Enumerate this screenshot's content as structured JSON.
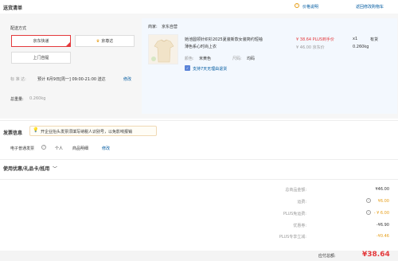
{
  "header": {
    "title": "送货清单",
    "price_note": "价格说明",
    "back_cart": "返回修改购物车"
  },
  "delivery": {
    "section_label": "配送方式",
    "options": [
      "京东快递",
      "京尊达",
      "上门自提"
    ],
    "selected_index": 0,
    "time_label": "标 准 达:",
    "time_value": "预计 6月9日[周一] 09:00-21:00 送达",
    "modify": "修改",
    "weight_label": "总重量:",
    "weight_value": "0.260kg"
  },
  "merchant": {
    "label": "商家:",
    "name": "京东自营"
  },
  "product": {
    "title_line1": "她池圆领针织衫2025夏装新款女装简约短袖",
    "title_line2": "薄色系心时尚上衣",
    "price": "¥ 38.64 PLUS到手价",
    "orig_price": "¥ 46.00 京东价",
    "qty": "x1",
    "stock": "有货",
    "weight": "0.260kg",
    "color_label": "颜色:",
    "color_value": "米黄色",
    "size_label": "尺码:",
    "size_value": "均码",
    "return_policy": "支持7天无理由退货"
  },
  "invoice": {
    "title": "发票信息",
    "notice": "开企业抬头发票须填写纳税人识别号，以免影响报销",
    "type": "电子普通发票",
    "target": "个人",
    "content": "商品明细",
    "modify": "修改"
  },
  "coupon": {
    "title": "使用优惠/礼品卡/抵用"
  },
  "summary": {
    "rows": [
      {
        "label": "总商品金额:",
        "value": "¥46.00"
      },
      {
        "label": "运费:",
        "value": "¥6.00"
      },
      {
        "label": "PLUS免运费:",
        "value": "- ¥ 6.00"
      },
      {
        "label": "优惠券:",
        "value": "-¥6.90"
      },
      {
        "label": "PLUS专享立减:",
        "value": "-¥0.46"
      }
    ],
    "total_label": "应付总额:",
    "total_value": "¥38.64"
  },
  "colors": {
    "accent_red": "#e4393c",
    "accent_orange": "#e69e19",
    "link_blue": "#005aa0"
  }
}
